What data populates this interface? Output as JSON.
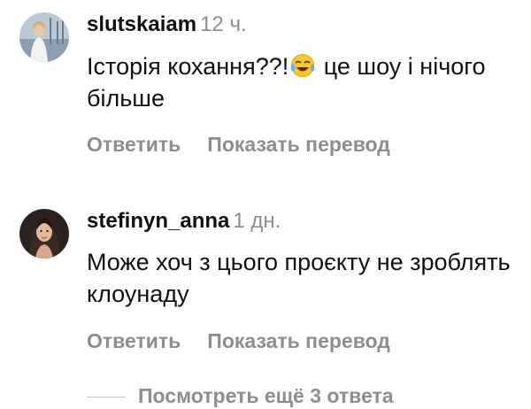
{
  "comments": [
    {
      "username": "slutskaiam",
      "time": "12 ч.",
      "text_before_emoji": "Історія кохання??!",
      "emoji": "face-with-tears-of-joy-icon",
      "text_after_emoji": " це шоу і нічого більше",
      "reply_label": "Ответить",
      "translate_label": "Показать перевод"
    },
    {
      "username": "stefinyn_anna",
      "time": "1 дн.",
      "text": "Може хоч з цього проєкту не зроблять клоунаду",
      "reply_label": "Ответить",
      "translate_label": "Показать перевод"
    }
  ],
  "view_replies_label": "Посмотреть ещё 3 ответа",
  "colors": {
    "text": "#111111",
    "secondary": "#8e8e8e",
    "background": "#ffffff"
  }
}
